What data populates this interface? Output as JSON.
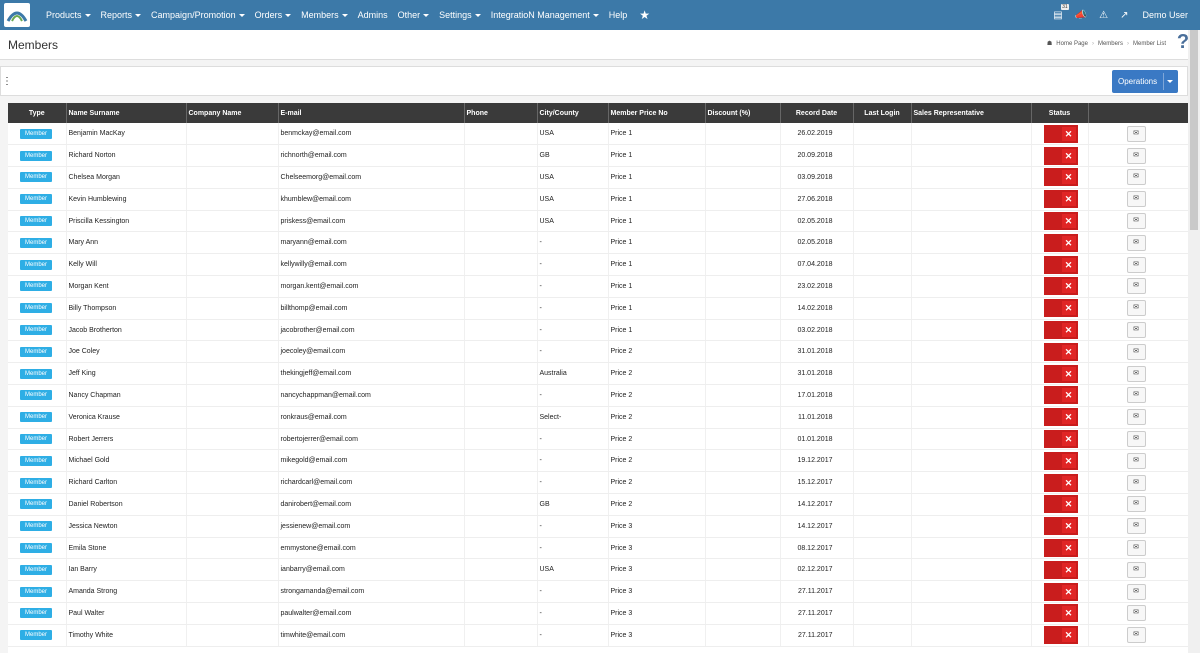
{
  "nav": {
    "items": [
      {
        "label": "Products",
        "caret": true
      },
      {
        "label": "Reports",
        "caret": true
      },
      {
        "label": "Campaign/Promotion",
        "caret": true
      },
      {
        "label": "Orders",
        "caret": true
      },
      {
        "label": "Members",
        "caret": true
      },
      {
        "label": "Admins",
        "caret": false
      },
      {
        "label": "Other",
        "caret": true
      },
      {
        "label": "Settings",
        "caret": true
      },
      {
        "label": "IntegratioN Management",
        "caret": true
      },
      {
        "label": "Help",
        "caret": false
      }
    ],
    "user": "Demo User",
    "icons": [
      "calendar-icon",
      "megaphone-icon",
      "alert-icon",
      "external-link-icon"
    ]
  },
  "header": {
    "title": "Members",
    "breadcrumb": [
      "Home Page",
      "Members",
      "Member List"
    ],
    "help_icon": "?"
  },
  "toolbar": {
    "operations_label": "Operations"
  },
  "table": {
    "headers": [
      "Type",
      "Name Surname",
      "Company Name",
      "E-mail",
      "Phone",
      "City/County",
      "Member Price No",
      "Discount (%)",
      "Record Date",
      "Last Login",
      "Sales Representative",
      "Status",
      ""
    ],
    "type_label": "Member",
    "rows": [
      {
        "name": "Benjamin MacKay",
        "company": "",
        "email": "benmckay@email.com",
        "phone": "",
        "city": "USA",
        "price": "Price 1",
        "discount": "",
        "date": "26.02.2019",
        "login": "",
        "rep": ""
      },
      {
        "name": "Richard Norton",
        "company": "",
        "email": "richnorth@email.com",
        "phone": "",
        "city": "GB",
        "price": "Price 1",
        "discount": "",
        "date": "20.09.2018",
        "login": "",
        "rep": ""
      },
      {
        "name": "Chelsea Morgan",
        "company": "",
        "email": "Chelseemorg@email.com",
        "phone": "",
        "city": "USA",
        "price": "Price 1",
        "discount": "",
        "date": "03.09.2018",
        "login": "",
        "rep": ""
      },
      {
        "name": "Kevin Humblewing",
        "company": "",
        "email": "khumblew@email.com",
        "phone": "",
        "city": "USA",
        "price": "Price 1",
        "discount": "",
        "date": "27.06.2018",
        "login": "",
        "rep": ""
      },
      {
        "name": "Priscilla Kessington",
        "company": "",
        "email": "priskess@email.com",
        "phone": "",
        "city": "USA",
        "price": "Price 1",
        "discount": "",
        "date": "02.05.2018",
        "login": "",
        "rep": ""
      },
      {
        "name": "Mary Ann",
        "company": "",
        "email": "maryann@email.com",
        "phone": "",
        "city": "-",
        "price": "Price 1",
        "discount": "",
        "date": "02.05.2018",
        "login": "",
        "rep": ""
      },
      {
        "name": "Kelly Will",
        "company": "",
        "email": "kellywilly@email.com",
        "phone": "",
        "city": "-",
        "price": "Price 1",
        "discount": "",
        "date": "07.04.2018",
        "login": "",
        "rep": ""
      },
      {
        "name": "Morgan Kent",
        "company": "",
        "email": "morgan.kent@email.com",
        "phone": "",
        "city": "-",
        "price": "Price 1",
        "discount": "",
        "date": "23.02.2018",
        "login": "",
        "rep": ""
      },
      {
        "name": "Billy Thompson",
        "company": "",
        "email": "billthomp@email.com",
        "phone": "",
        "city": "-",
        "price": "Price 1",
        "discount": "",
        "date": "14.02.2018",
        "login": "",
        "rep": ""
      },
      {
        "name": "Jacob Brotherton",
        "company": "",
        "email": "jacobrother@email.com",
        "phone": "",
        "city": "-",
        "price": "Price 1",
        "discount": "",
        "date": "03.02.2018",
        "login": "",
        "rep": ""
      },
      {
        "name": "Joe Coley",
        "company": "",
        "email": "joecoley@email.com",
        "phone": "",
        "city": "-",
        "price": "Price 2",
        "discount": "",
        "date": "31.01.2018",
        "login": "",
        "rep": ""
      },
      {
        "name": "Jeff King",
        "company": "",
        "email": "thekingjeff@email.com",
        "phone": "",
        "city": "Australia",
        "price": "Price 2",
        "discount": "",
        "date": "31.01.2018",
        "login": "",
        "rep": ""
      },
      {
        "name": "Nancy Chapman",
        "company": "",
        "email": "nancychappman@email.com",
        "phone": "",
        "city": "-",
        "price": "Price 2",
        "discount": "",
        "date": "17.01.2018",
        "login": "",
        "rep": ""
      },
      {
        "name": "Veronica Krause",
        "company": "",
        "email": "ronkraus@email.com",
        "phone": "",
        "city": "Select-",
        "price": "Price 2",
        "discount": "",
        "date": "11.01.2018",
        "login": "",
        "rep": ""
      },
      {
        "name": "Robert Jerrers",
        "company": "",
        "email": "robertojerrer@email.com",
        "phone": "",
        "city": "-",
        "price": "Price 2",
        "discount": "",
        "date": "01.01.2018",
        "login": "",
        "rep": ""
      },
      {
        "name": "Michael Gold",
        "company": "",
        "email": "mikegold@email.com",
        "phone": "",
        "city": "-",
        "price": "Price 2",
        "discount": "",
        "date": "19.12.2017",
        "login": "",
        "rep": ""
      },
      {
        "name": "Richard Carlton",
        "company": "",
        "email": "richardcarl@email.com",
        "phone": "",
        "city": "-",
        "price": "Price 2",
        "discount": "",
        "date": "15.12.2017",
        "login": "",
        "rep": ""
      },
      {
        "name": "Daniel Robertson",
        "company": "",
        "email": "danirobert@email.com",
        "phone": "",
        "city": "GB",
        "price": "Price 2",
        "discount": "",
        "date": "14.12.2017",
        "login": "",
        "rep": ""
      },
      {
        "name": "Jessica Newton",
        "company": "",
        "email": "jessienew@email.com",
        "phone": "",
        "city": "-",
        "price": "Price 3",
        "discount": "",
        "date": "14.12.2017",
        "login": "",
        "rep": ""
      },
      {
        "name": "Emila Stone",
        "company": "",
        "email": "emmystone@email.com",
        "phone": "",
        "city": "-",
        "price": "Price 3",
        "discount": "",
        "date": "08.12.2017",
        "login": "",
        "rep": ""
      },
      {
        "name": "Ian Barry",
        "company": "",
        "email": "ianbarry@email.com",
        "phone": "",
        "city": "USA",
        "price": "Price 3",
        "discount": "",
        "date": "02.12.2017",
        "login": "",
        "rep": ""
      },
      {
        "name": "Amanda Strong",
        "company": "",
        "email": "strongamanda@email.com",
        "phone": "",
        "city": "-",
        "price": "Price 3",
        "discount": "",
        "date": "27.11.2017",
        "login": "",
        "rep": ""
      },
      {
        "name": "Paul Walter",
        "company": "",
        "email": "paulwalter@email.com",
        "phone": "",
        "city": "-",
        "price": "Price 3",
        "discount": "",
        "date": "27.11.2017",
        "login": "",
        "rep": ""
      },
      {
        "name": "Timothy White",
        "company": "",
        "email": "timwhite@email.com",
        "phone": "",
        "city": "-",
        "price": "Price 3",
        "discount": "",
        "date": "27.11.2017",
        "login": "",
        "rep": ""
      }
    ]
  },
  "colors": {
    "topbar": "#3c79a8",
    "member_badge": "#2eaee5",
    "status_red": "#c91d1d",
    "operations": "#3a79c4",
    "table_header": "#3a3a3a"
  }
}
